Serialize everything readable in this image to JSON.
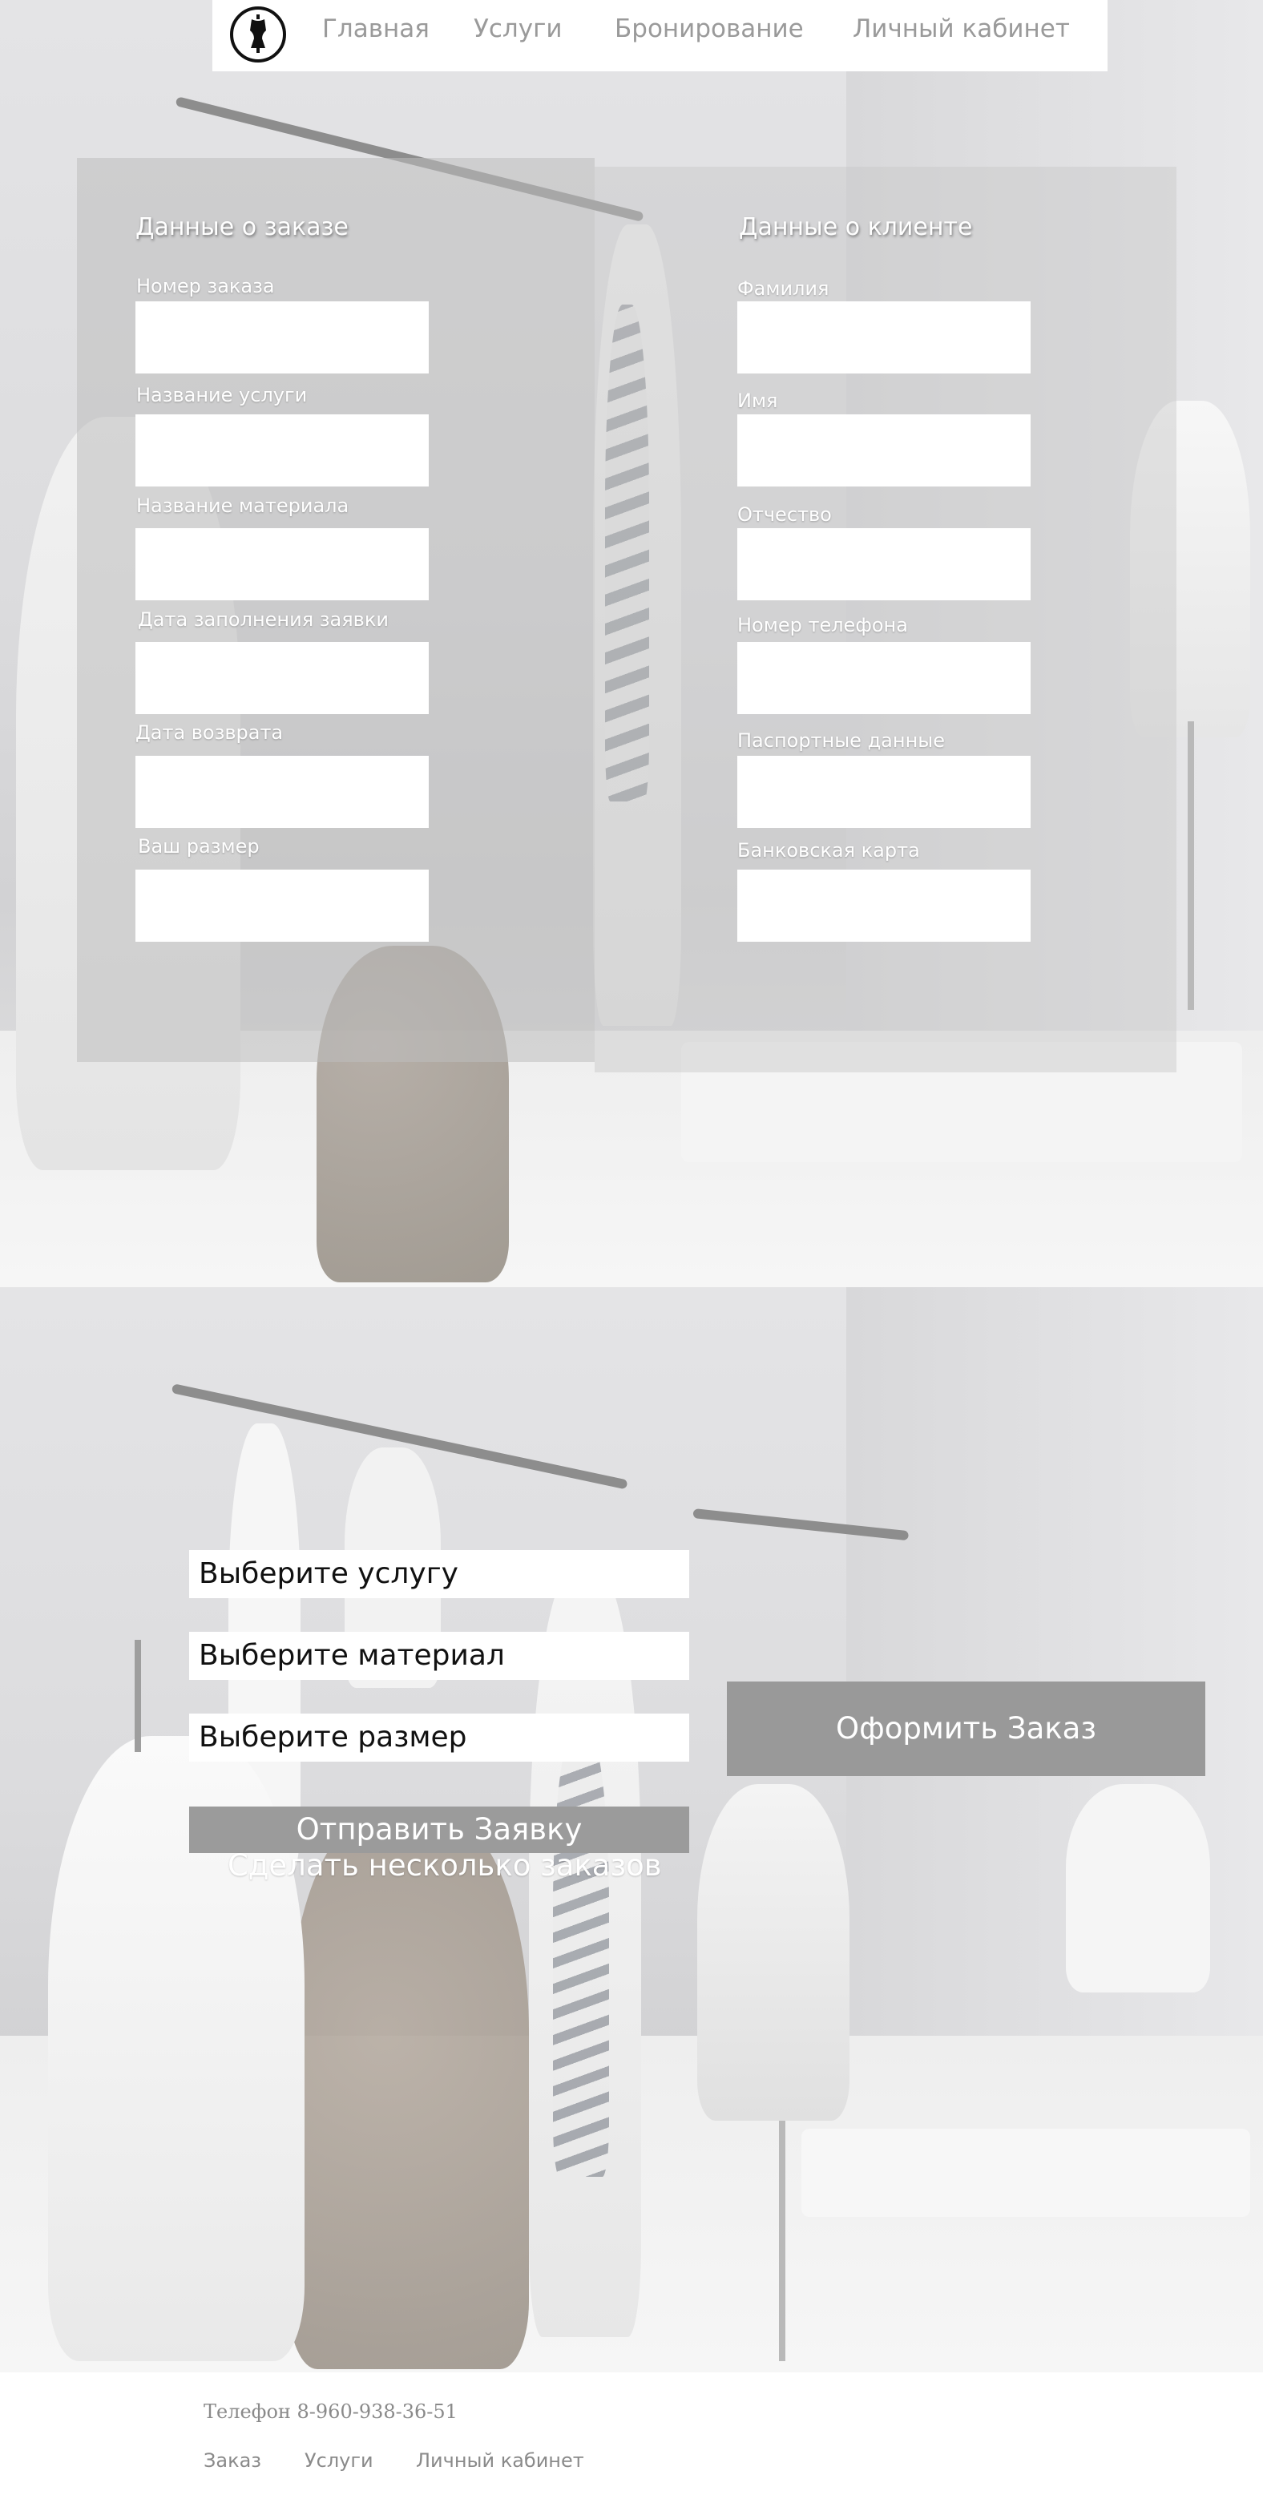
{
  "header": {
    "logo_icon": "mannequin-icon",
    "nav": [
      {
        "label": "Главная"
      },
      {
        "label": "Услуги"
      },
      {
        "label": "Бронирование"
      },
      {
        "label": "Личный кабинет"
      }
    ]
  },
  "order_form": {
    "order_section": {
      "title": "Данные о заказе",
      "fields": [
        {
          "label": "Номер заказа",
          "value": ""
        },
        {
          "label": "Название услуги",
          "value": ""
        },
        {
          "label": "Название материала",
          "value": ""
        },
        {
          "label": "Дата заполнения заявки",
          "value": ""
        },
        {
          "label": "Дата возврата",
          "value": ""
        },
        {
          "label": "Ваш размер",
          "value": ""
        }
      ]
    },
    "client_section": {
      "title": "Данные о клиенте",
      "fields": [
        {
          "label": "Фамилия",
          "value": ""
        },
        {
          "label": "Имя",
          "value": ""
        },
        {
          "label": "Отчество",
          "value": ""
        },
        {
          "label": "Номер телефона",
          "value": ""
        },
        {
          "label": "Паспортные данные",
          "value": ""
        },
        {
          "label": "Банковская карта",
          "value": ""
        }
      ]
    }
  },
  "request_form": {
    "selects": [
      {
        "value": "Выберите услугу"
      },
      {
        "value": "Выберите материал"
      },
      {
        "value": "Выберите размер"
      }
    ],
    "send_button": "Отправить Заявку",
    "multi_order_link": "Сделать несколько заказов",
    "checkout_button": "Оформить Заказ"
  },
  "footer": {
    "phone": "Телефон 8-960-938-36-51",
    "links": [
      {
        "label": "Заказ"
      },
      {
        "label": "Услуги"
      },
      {
        "label": "Личный кабинет"
      }
    ]
  },
  "colors": {
    "nav_text": "#9a9a9a",
    "button_bg": "#9b9b9b",
    "panel_overlay": "#bebebe"
  }
}
